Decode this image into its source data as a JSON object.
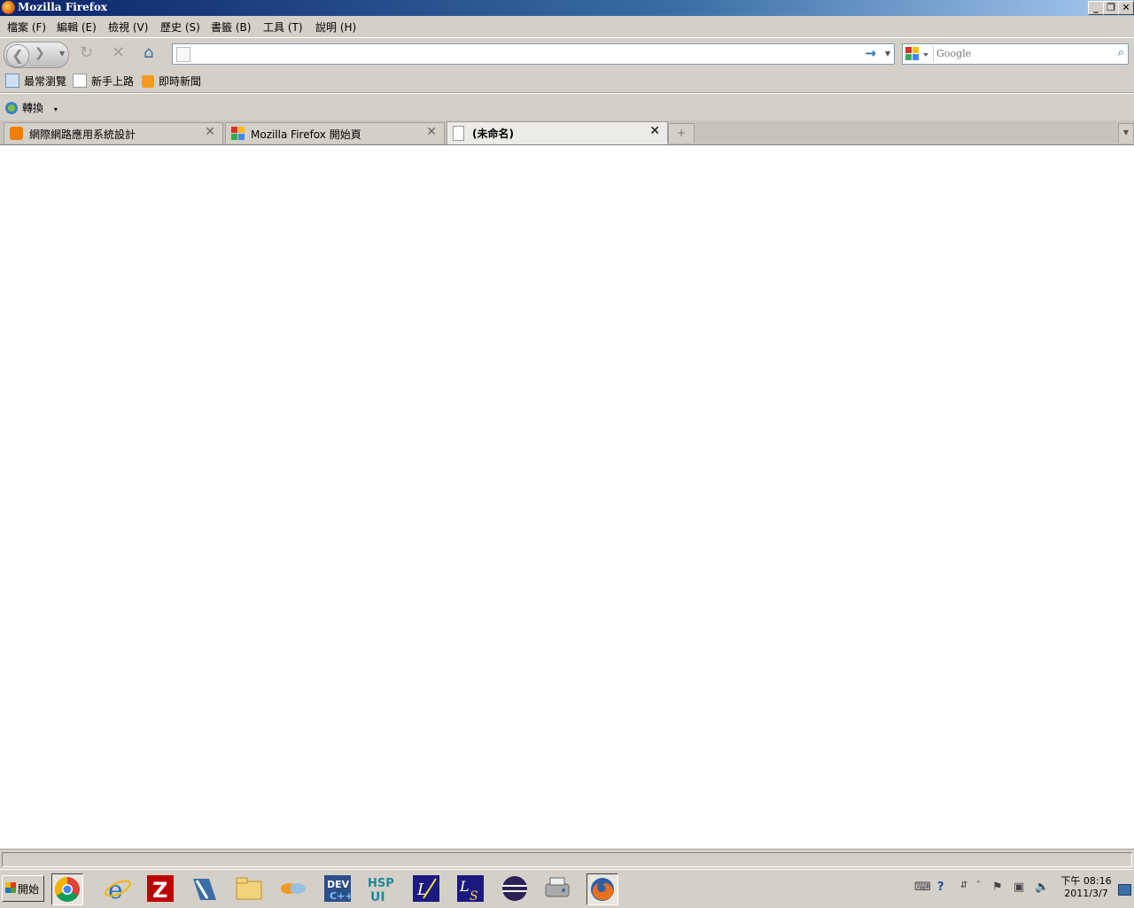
{
  "window": {
    "title": "Mozilla Firefox",
    "controls": {
      "minimize": "_",
      "maximize": "❐",
      "close": "✕"
    }
  },
  "menu": [
    "檔案 (F)",
    "編輯 (E)",
    "檢視 (V)",
    "歷史 (S)",
    "書籤 (B)",
    "工具 (T)",
    "說明 (H)"
  ],
  "navbar": {
    "back_icon": "back-arrow-icon",
    "forward_icon": "forward-arrow-icon",
    "reload_icon": "reload-icon",
    "stop_icon": "stop-icon",
    "home_icon": "home-icon",
    "url_value": "",
    "go_icon": "go-arrow-icon",
    "search_placeholder": "Google"
  },
  "bookmarks": [
    {
      "label": "最常瀏覽",
      "icon": "smart-folder-icon"
    },
    {
      "label": "新手上路",
      "icon": "page-icon"
    },
    {
      "label": "即時新聞",
      "icon": "rss-icon"
    }
  ],
  "extra_toolbar": {
    "convert_label": "轉換",
    "dropdown": "▾"
  },
  "tabs": [
    {
      "label": "網際網路應用系統設計",
      "icon": "blogger-icon",
      "selected": false
    },
    {
      "label": "Mozilla Firefox 開始頁",
      "icon": "google-icon",
      "selected": false
    },
    {
      "label": "(未命名)",
      "icon": "blank-page-icon",
      "selected": true
    }
  ],
  "taskbar": {
    "start_label": "開始",
    "apps": [
      "chrome-icon",
      "ie-icon",
      "filezilla-icon",
      "visual-studio-icon",
      "folder-icon",
      "silverlight-icon",
      "devcpp-icon",
      "hsp-ui-icon",
      "lua-editor-icon",
      "lua-studio-icon",
      "eclipse-icon",
      "printer-icon",
      "firefox-icon"
    ],
    "clock_time": "下午 08:16",
    "clock_date": "2011/3/7"
  },
  "colors": {
    "title_gradient_start": "#0a246a",
    "chrome_bg": "#d4d0c8",
    "content_bg": "#ffffff"
  }
}
